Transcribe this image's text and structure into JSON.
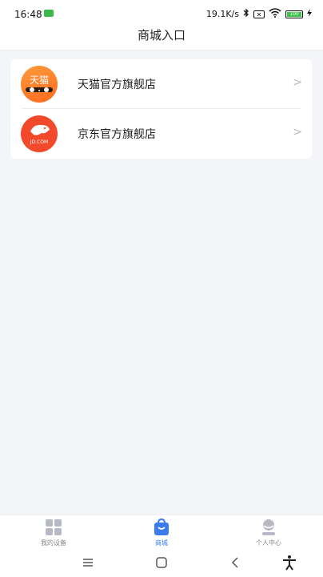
{
  "status_bar": {
    "time": "16:48",
    "net_speed": "19.1K/s",
    "battery_level": "100",
    "icons": [
      "message-icon",
      "bluetooth-icon",
      "sim-icon",
      "wifi-icon",
      "battery-icon",
      "charging-icon"
    ]
  },
  "header": {
    "title": "商城入口"
  },
  "shops": [
    {
      "name": "天猫官方旗舰店",
      "logo_text": "天猫",
      "logo_color": "#ff7a26"
    },
    {
      "name": "京东官方旗舰店",
      "logo_text": "JD.COM",
      "logo_color": "#f2492a"
    }
  ],
  "tab_bar": {
    "items": [
      {
        "label": "我的设备",
        "icon": "grid-icon",
        "active": false
      },
      {
        "label": "商城",
        "icon": "shopping-bag-icon",
        "active": true
      },
      {
        "label": "个人中心",
        "icon": "user-icon",
        "active": false
      }
    ],
    "active_color": "#3a7bf0"
  },
  "system_nav": {
    "icons": [
      "menu-icon",
      "home-icon",
      "back-icon",
      "accessibility-icon"
    ]
  }
}
